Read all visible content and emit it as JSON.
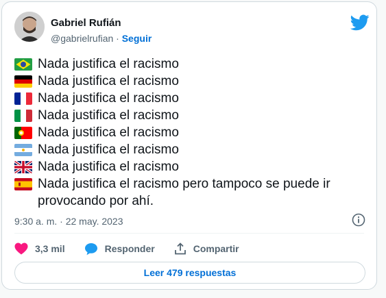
{
  "tweet": {
    "author": {
      "name": "Gabriel Rufián",
      "handle": "@gabrielrufian",
      "separator": "·",
      "follow_label": "Seguir"
    },
    "lines": [
      {
        "flag": "brazil-flag-icon",
        "text": "Nada justifica el racismo"
      },
      {
        "flag": "germany-flag-icon",
        "text": "Nada justifica el racismo"
      },
      {
        "flag": "france-flag-icon",
        "text": "Nada justifica el racismo"
      },
      {
        "flag": "italy-flag-icon",
        "text": "Nada justifica el racismo"
      },
      {
        "flag": "portugal-flag-icon",
        "text": "Nada justifica el racismo"
      },
      {
        "flag": "argentina-flag-icon",
        "text": "Nada justifica el racismo"
      },
      {
        "flag": "uk-flag-icon",
        "text": "Nada justifica el racismo"
      },
      {
        "flag": "spain-flag-icon",
        "text": "Nada justifica el racismo pero tampoco se puede ir provocando por ahí."
      }
    ],
    "timestamp": "9:30 a. m. · 22 may. 2023",
    "actions": {
      "likes": "3,3 mil",
      "reply_label": "Responder",
      "share_label": "Compartir"
    },
    "read_replies_label": "Leer 479 respuestas"
  },
  "colors": {
    "twitter_blue": "#1d9bf0",
    "link_blue": "#006fd6",
    "heart_pink": "#f91880",
    "muted_text": "#536471"
  }
}
